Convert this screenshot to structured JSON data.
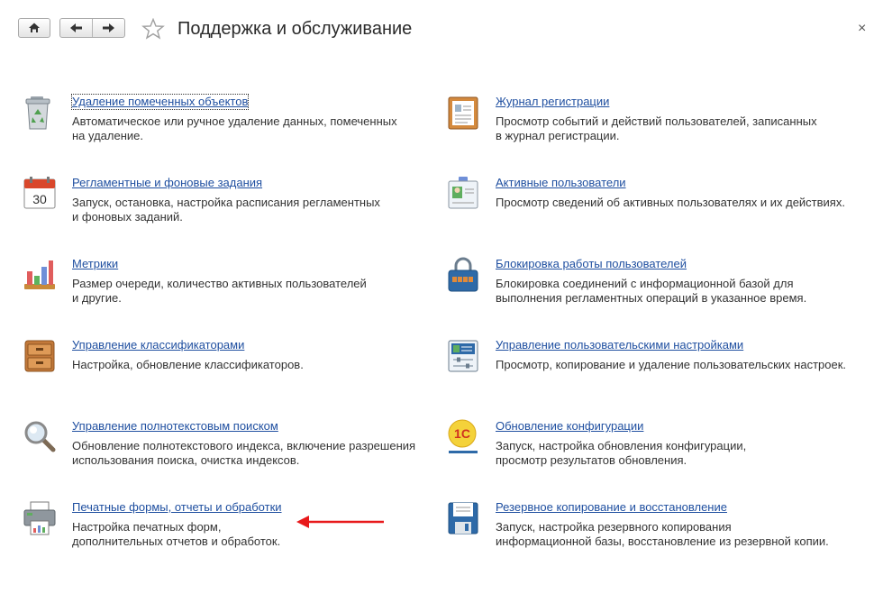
{
  "header": {
    "title": "Поддержка и обслуживание",
    "close_glyph": "×"
  },
  "left_items": [
    {
      "icon": "recycle-bin-icon",
      "link": "Удаление помеченных объектов",
      "desc": "Автоматическое или ручное удаление данных, помеченных\nна удаление."
    },
    {
      "icon": "calendar-icon",
      "link": "Регламентные и фоновые задания",
      "desc": "Запуск, остановка, настройка расписания регламентных\nи фоновых заданий.",
      "calendar_day": "30"
    },
    {
      "icon": "bar-chart-icon",
      "link": "Метрики",
      "desc": "Размер очереди, количество активных пользователей\nи другие."
    },
    {
      "icon": "file-cabinet-icon",
      "link": "Управление классификаторами",
      "desc": "Настройка, обновление классификаторов."
    },
    {
      "icon": "magnifier-icon",
      "link": "Управление полнотекстовым поиском",
      "desc": "Обновление полнотекстового индекса, включение разрешения\nиспользования поиска, очистка индексов."
    },
    {
      "icon": "printer-icon",
      "link": "Печатные формы, отчеты и обработки",
      "desc": "Настройка печатных форм,\nдополнительных отчетов и обработок."
    }
  ],
  "right_items": [
    {
      "icon": "registration-log-icon",
      "link": "Журнал регистрации",
      "desc": "Просмотр событий и действий пользователей, записанных\nв журнал регистрации."
    },
    {
      "icon": "active-users-icon",
      "link": "Активные пользователи",
      "desc": "Просмотр сведений об активных пользователях и их действиях."
    },
    {
      "icon": "lock-icon",
      "link": "Блокировка работы пользователей",
      "desc": "Блокировка соединений с информационной базой для\nвыполнения регламентных операций в указанное время."
    },
    {
      "icon": "user-settings-icon",
      "link": "Управление пользовательскими настройками",
      "desc": "Просмотр, копирование и удаление пользовательских настроек."
    },
    {
      "icon": "1c-update-icon",
      "link": "Обновление конфигурации",
      "desc": "Запуск, настройка обновления конфигурации,\nпросмотр результатов обновления.",
      "logo_text": "1С"
    },
    {
      "icon": "floppy-disk-icon",
      "link": "Резервное копирование и восстановление",
      "desc": "Запуск, настройка резервного копирования\nинформационной базы, восстановление из резервной копии."
    }
  ],
  "colors": {
    "link": "#1f4fa0",
    "annotation_arrow": "#e8191b"
  }
}
